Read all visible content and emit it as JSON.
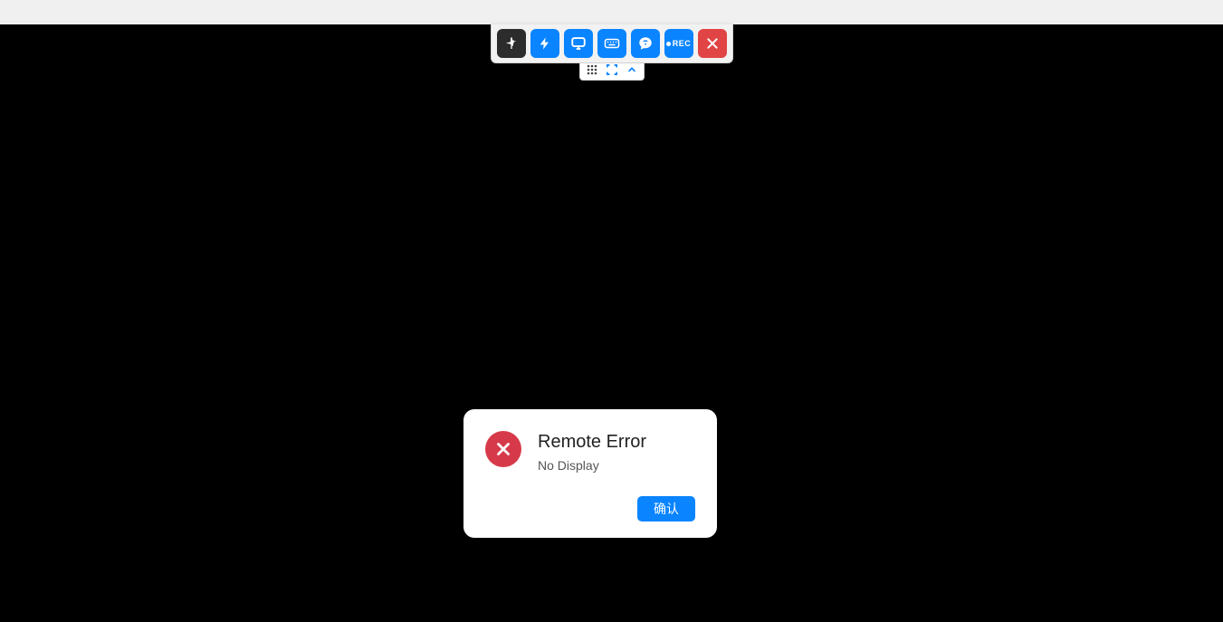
{
  "toolbar": {
    "pin_icon": "pin-icon",
    "action_icon": "lightning-icon",
    "display_icon": "monitor-icon",
    "keyboard_icon": "keyboard-icon",
    "chat_icon": "chat-icon",
    "record_label": "REC",
    "close_icon": "close-icon"
  },
  "subtoolbar": {
    "grid_icon": "grid-icon",
    "fullscreen_icon": "fullscreen-icon",
    "collapse_icon": "chevron-up-icon"
  },
  "dialog": {
    "title": "Remote Error",
    "message": "No Display",
    "confirm_label": "确认"
  }
}
